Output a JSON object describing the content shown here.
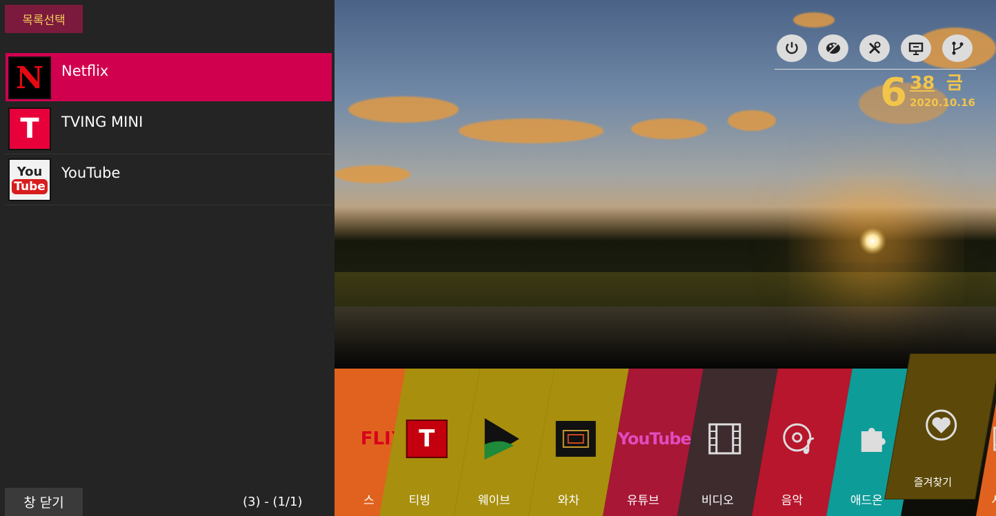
{
  "panel": {
    "title": "목록선택",
    "items": [
      {
        "name": "Netflix",
        "icon": "netflix-logo",
        "selected": true
      },
      {
        "name": "TVING MINI",
        "icon": "tving-logo",
        "selected": false
      },
      {
        "name": "YouTube",
        "icon": "youtube-logo",
        "selected": false
      }
    ],
    "close_label": "창 닫기",
    "pager": "(3)  -  (1/1)"
  },
  "system": {
    "icons": [
      "power-icon",
      "palette-icon",
      "tools-icon",
      "presentation-icon",
      "branch-icon"
    ],
    "clock": {
      "hour": "6",
      "minute": "38",
      "day": "금",
      "date": "2020.10.16"
    }
  },
  "ribbon": {
    "tiles": [
      {
        "label": "스",
        "logo_text": "FLIX",
        "color": "#e0621e"
      },
      {
        "label": "티빙",
        "color": "#a88f0e"
      },
      {
        "label": "웨이브",
        "color": "#a88f0e"
      },
      {
        "label": "와차",
        "color": "#a88f0e"
      },
      {
        "label": "유튜브",
        "logo_text": "YouTube",
        "color": "#a81735"
      },
      {
        "label": "비디오",
        "color": "#3d2b2e"
      },
      {
        "label": "음악",
        "color": "#b8162c"
      },
      {
        "label": "애드온",
        "color": "#0e9c98"
      },
      {
        "label": "사진",
        "color": "#e0621e"
      }
    ],
    "favorite": {
      "label": "즐겨찾기",
      "color": "#5c4808"
    }
  },
  "logos": {
    "netflix": "N",
    "tving": "T",
    "youtube_top": "You",
    "youtube_bottom": "Tube"
  }
}
